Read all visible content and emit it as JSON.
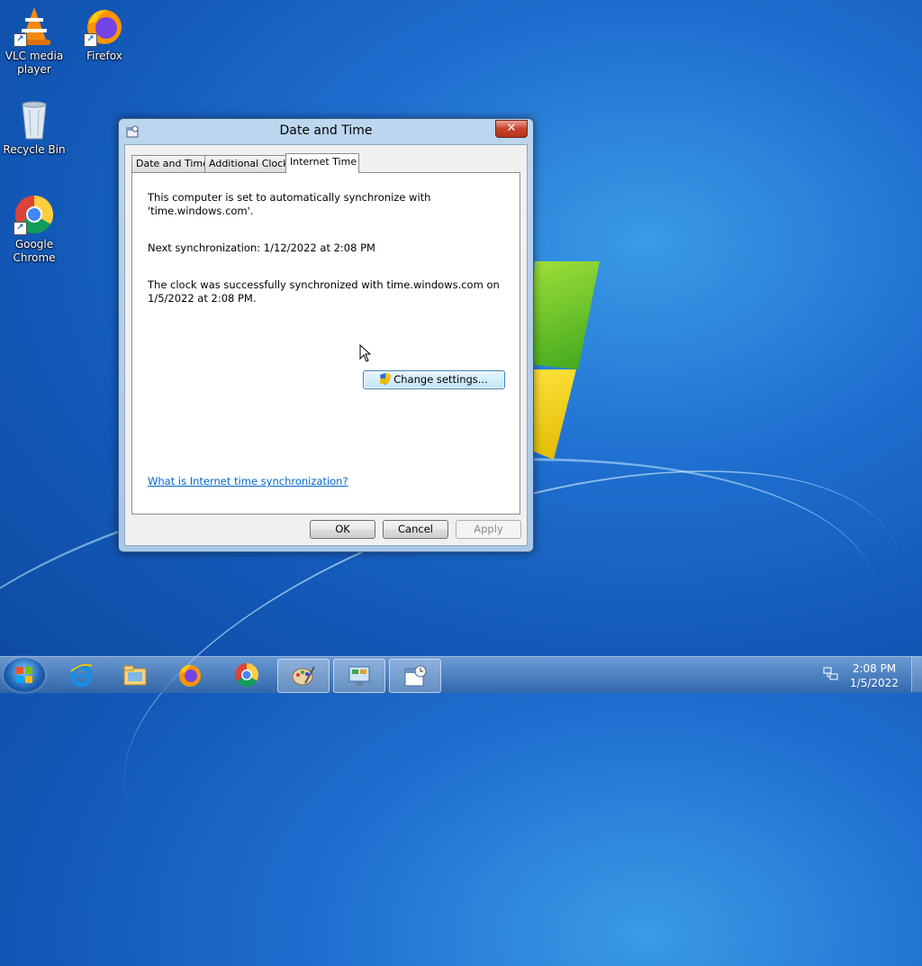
{
  "desktop": {
    "icons": [
      {
        "label": "VLC media player"
      },
      {
        "label": "Firefox"
      },
      {
        "label": "Recycle Bin"
      },
      {
        "label": "Google Chrome"
      }
    ]
  },
  "dialog": {
    "title": "Date and Time",
    "close_label": "✕",
    "tabs": [
      {
        "label": "Date and Time"
      },
      {
        "label": "Additional Clocks"
      },
      {
        "label": "Internet Time"
      }
    ],
    "active_tab": "Internet Time",
    "sync_info_line1": "This computer is set to automatically synchronize with",
    "sync_info_line2": "'time.windows.com'.",
    "next_sync": "Next synchronization: 1/12/2022 at 2:08 PM",
    "last_sync_line1": "The clock was successfully synchronized with time.windows.com on",
    "last_sync_line2": "1/5/2022 at 2:08 PM.",
    "change_settings_label": "Change settings...",
    "help_link": "What is Internet time synchronization?",
    "ok_label": "OK",
    "cancel_label": "Cancel",
    "apply_label": "Apply"
  },
  "taskbar": {
    "items": [
      {
        "icon": "internet-explorer-icon"
      },
      {
        "icon": "file-explorer-icon"
      },
      {
        "icon": "firefox-icon"
      },
      {
        "icon": "chrome-icon"
      },
      {
        "icon": "paint-icon"
      },
      {
        "icon": "control-panel-icon"
      },
      {
        "icon": "date-time-icon"
      }
    ],
    "clock_time": "2:08 PM",
    "clock_date": "1/5/2022"
  }
}
